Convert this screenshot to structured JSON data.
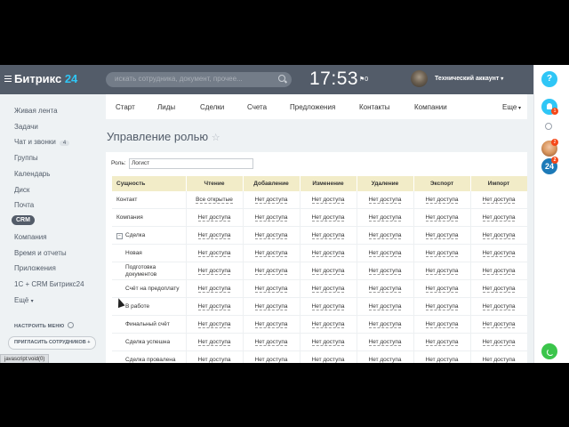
{
  "header": {
    "logo_text": "Битрикс",
    "logo_num": "24",
    "search_placeholder": "искать сотрудника, документ, прочее...",
    "time": "17:53",
    "flag_count": "0",
    "account_name": "Технический аккаунт"
  },
  "rail": {
    "help": "?",
    "bell_badge": "1",
    "face_badge": "2",
    "b24_label": "24",
    "b24_badge": "2"
  },
  "sidebar": {
    "items": [
      {
        "label": "Живая лента"
      },
      {
        "label": "Задачи"
      },
      {
        "label": "Чат и звонки",
        "count": "4"
      },
      {
        "label": "Группы"
      },
      {
        "label": "Календарь"
      },
      {
        "label": "Диск"
      },
      {
        "label": "Почта"
      },
      {
        "label": "CRM"
      },
      {
        "label": "Компания"
      },
      {
        "label": "Время и отчеты"
      },
      {
        "label": "Приложения"
      },
      {
        "label": "1С + CRM Битрикс24"
      },
      {
        "label": "Ещё"
      }
    ],
    "setup_menu": "НАСТРОИТЬ МЕНЮ",
    "invite": "ПРИГЛАСИТЬ СОТРУДНИКОВ",
    "status_url": "javascript:void(0)"
  },
  "tabs": [
    "Старт",
    "Лиды",
    "Сделки",
    "Счета",
    "Предложения",
    "Контакты",
    "Компании"
  ],
  "tabs_more": "Еще",
  "page_title": "Управление ролью",
  "role": {
    "label": "Роль:",
    "value": "Логист"
  },
  "table": {
    "headers": [
      "Сущность",
      "Чтение",
      "Добавление",
      "Изменение",
      "Удаление",
      "Экспорт",
      "Импорт"
    ],
    "rows": [
      {
        "name": "Контакт",
        "cells": [
          "Все открытые",
          "Нет доступа",
          "Нет доступа",
          "Нет доступа",
          "Нет доступа",
          "Нет доступа"
        ]
      },
      {
        "name": "Компания",
        "cells": [
          "Нет доступа",
          "Нет доступа",
          "Нет доступа",
          "Нет доступа",
          "Нет доступа",
          "Нет доступа"
        ]
      },
      {
        "name": "Сделка",
        "cells": [
          "Нет доступа",
          "Нет доступа",
          "Нет доступа",
          "Нет доступа",
          "Нет доступа",
          "Нет доступа"
        ]
      },
      {
        "name": "Новая",
        "cells": [
          "Нет доступа",
          "Нет доступа",
          "Нет доступа",
          "Нет доступа",
          "Нет доступа",
          "Нет доступа"
        ]
      },
      {
        "name": "Подготовка документов",
        "cells": [
          "Нет доступа",
          "Нет доступа",
          "Нет доступа",
          "Нет доступа",
          "Нет доступа",
          "Нет доступа"
        ]
      },
      {
        "name": "Счёт на предоплату",
        "cells": [
          "Нет доступа",
          "Нет доступа",
          "Нет доступа",
          "Нет доступа",
          "Нет доступа",
          "Нет доступа"
        ]
      },
      {
        "name": "В работе",
        "cells": [
          "Нет доступа",
          "Нет доступа",
          "Нет доступа",
          "Нет доступа",
          "Нет доступа",
          "Нет доступа"
        ]
      },
      {
        "name": "Финальный счёт",
        "cells": [
          "Нет доступа",
          "Нет доступа",
          "Нет доступа",
          "Нет доступа",
          "Нет доступа",
          "Нет доступа"
        ]
      },
      {
        "name": "Сделка успешна",
        "cells": [
          "Нет доступа",
          "Нет доступа",
          "Нет доступа",
          "Нет доступа",
          "Нет доступа",
          "Нет доступа"
        ]
      },
      {
        "name": "Сделка провалена",
        "cells": [
          "Нет доступа",
          "Нет доступа",
          "Нет доступа",
          "Нет доступа",
          "Нет доступа",
          "Нет доступа"
        ]
      }
    ]
  }
}
